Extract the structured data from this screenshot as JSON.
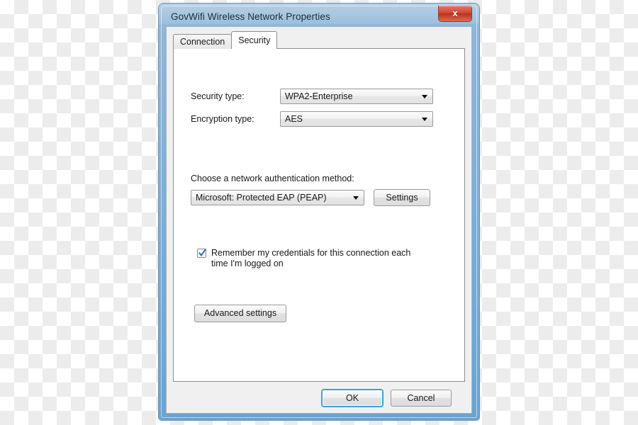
{
  "window": {
    "title": "GovWifi Wireless Network Properties",
    "close_label": "x"
  },
  "tabs": [
    {
      "label": "Connection",
      "active": false
    },
    {
      "label": "Security",
      "active": true
    }
  ],
  "security_tab": {
    "security_type": {
      "label": "Security type:",
      "value": "WPA2-Enterprise"
    },
    "encryption_type": {
      "label": "Encryption type:",
      "value": "AES"
    },
    "auth_method": {
      "label": "Choose a network authentication method:",
      "value": "Microsoft: Protected EAP (PEAP)",
      "settings_button": "Settings"
    },
    "remember_credentials": {
      "label": "Remember my credentials for this connection each time I'm logged on",
      "checked": true
    },
    "advanced_settings_button": "Advanced settings"
  },
  "footer": {
    "ok_label": "OK",
    "cancel_label": "Cancel"
  },
  "colors": {
    "frame_blue": "#6ba3cf",
    "close_red": "#d14a33",
    "focus_blue": "#3c9fdc",
    "check_blue": "#2f6fa8",
    "client_gray": "#f0f0f0"
  }
}
